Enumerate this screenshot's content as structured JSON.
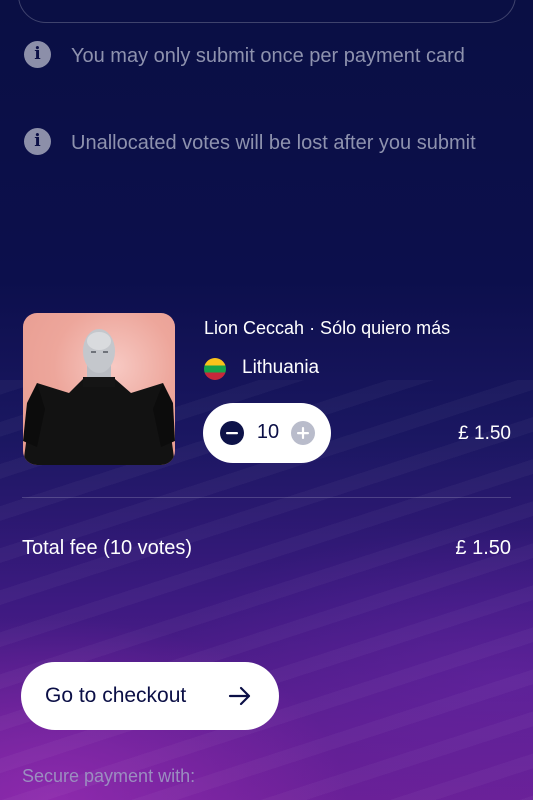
{
  "notices": [
    {
      "icon": "info-icon",
      "text": "You may only submit once per payment card"
    },
    {
      "icon": "info-icon",
      "text": "Unallocated votes will be lost after you submit"
    }
  ],
  "entry": {
    "title": "Lion Ceccah · Sólo quiero más",
    "country": "Lithuania",
    "flag": "lithuania-flag-icon",
    "votes": "10",
    "price": "£ 1.50",
    "minus_icon": "minus-icon",
    "plus_icon": "plus-icon"
  },
  "total": {
    "label": "Total fee (10 votes)",
    "amount": "£ 1.50"
  },
  "checkout": {
    "label": "Go to checkout",
    "icon": "arrow-right-icon"
  },
  "secure_payment_label": "Secure payment with:",
  "colors": {
    "background_top": "#0a0f44",
    "background_bottom": "#6a2097",
    "muted_text": "#8e92ae",
    "button_bg": "#ffffff",
    "button_text": "#0b0f46"
  }
}
